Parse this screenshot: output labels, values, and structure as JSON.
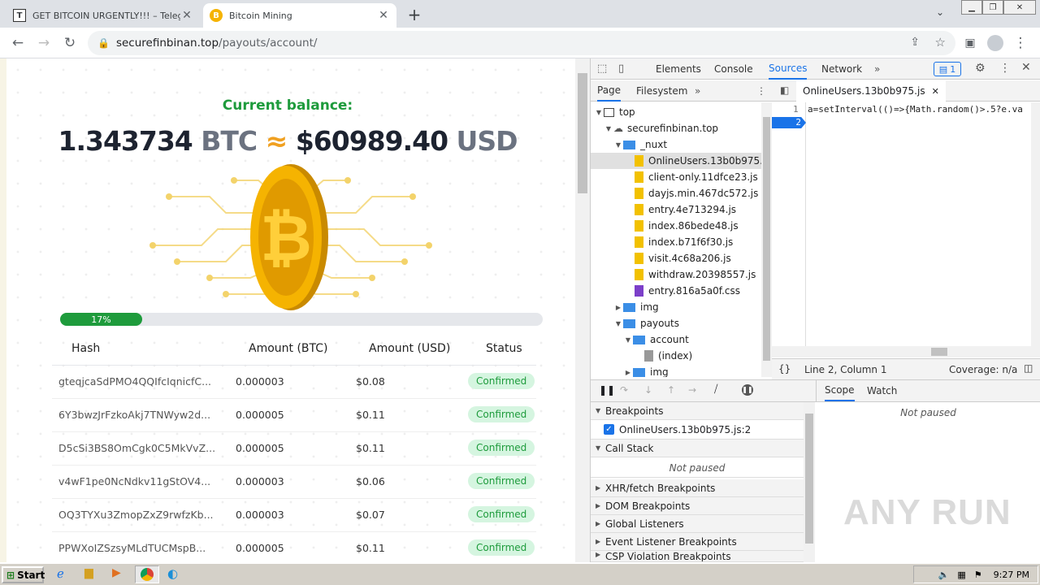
{
  "browser": {
    "tabs": [
      {
        "title": "GET BITCOIN URGENTLY!!! – Telegra",
        "favicon": "T"
      },
      {
        "title": "Bitcoin Mining",
        "favicon": "B"
      }
    ],
    "new_tab": "+",
    "url_host": "securefinbinan.top",
    "url_path": "/payouts/account/"
  },
  "page": {
    "balance_label": "Current balance:",
    "btc_value": "1.343734",
    "btc_unit": "BTC",
    "approx": "≈",
    "usd_value": "$60989.40",
    "usd_unit": "USD",
    "progress_label": "17%",
    "progress_fraction": 0.17,
    "table_headers": [
      "Hash",
      "Amount (BTC)",
      "Amount (USD)",
      "Status"
    ],
    "rows": [
      {
        "hash": "gteqjcaSdPMO4QQIfcIqnicfC...",
        "btc": "0.000003",
        "usd": "$0.08",
        "status": "Confirmed"
      },
      {
        "hash": "6Y3bwzJrFzkoAkj7TNWyw2d...",
        "btc": "0.000005",
        "usd": "$0.11",
        "status": "Confirmed"
      },
      {
        "hash": "D5cSi3BS8OmCgk0C5MkVvZ...",
        "btc": "0.000005",
        "usd": "$0.11",
        "status": "Confirmed"
      },
      {
        "hash": "v4wF1pe0NcNdkv11gStOV4...",
        "btc": "0.000003",
        "usd": "$0.06",
        "status": "Confirmed"
      },
      {
        "hash": "OQ3TYXu3ZmopZxZ9rwfzKb...",
        "btc": "0.000003",
        "usd": "$0.07",
        "status": "Confirmed"
      },
      {
        "hash": "PPWXoIZSzsyMLdTUCMspB...",
        "btc": "0.000005",
        "usd": "$0.11",
        "status": "Confirmed"
      }
    ]
  },
  "devtools": {
    "tabs": [
      "Elements",
      "Console",
      "Sources",
      "Network"
    ],
    "active_tab": "Sources",
    "more": "»",
    "issues_count": "1",
    "nav_tabs": [
      "Page",
      "Filesystem"
    ],
    "tree": {
      "top": "top",
      "origin": "securefinbinan.top",
      "nuxt": "_nuxt",
      "nuxt_files": [
        "OnlineUsers.13b0b975.js",
        "client-only.11dfce23.js",
        "dayjs.min.467dc572.js",
        "entry.4e713294.js",
        "index.86bede48.js",
        "index.b71f6f30.js",
        "visit.4c68a206.js",
        "withdraw.20398557.js",
        "entry.816a5a0f.css"
      ],
      "img": "img",
      "payouts": "payouts",
      "account": "account",
      "index": "(index)",
      "img2": "img"
    },
    "editor_tab": "OnlineUsers.13b0b975.js",
    "code_line1": "a=setInterval(()=>{Math.random()>.5?e.va",
    "line_numbers": [
      "1",
      "2"
    ],
    "status_position": "Line 2, Column 1",
    "coverage": "Coverage: n/a",
    "breakpoints_header": "Breakpoints",
    "breakpoint_item": "OnlineUsers.13b0b975.js:2",
    "callstack_header": "Call Stack",
    "not_paused": "Not paused",
    "sections": [
      "XHR/fetch Breakpoints",
      "DOM Breakpoints",
      "Global Listeners",
      "Event Listener Breakpoints",
      "CSP Violation Breakpoints"
    ],
    "scope_tab": "Scope",
    "watch_tab": "Watch",
    "scope_not_paused": "Not paused"
  },
  "taskbar": {
    "start": "Start",
    "time": "9:27 PM"
  },
  "watermark": "ANY RUN",
  "colors": {
    "accent_green": "#1e9b3c",
    "devtools_blue": "#1a73e8",
    "coin_gold": "#f5b301"
  }
}
